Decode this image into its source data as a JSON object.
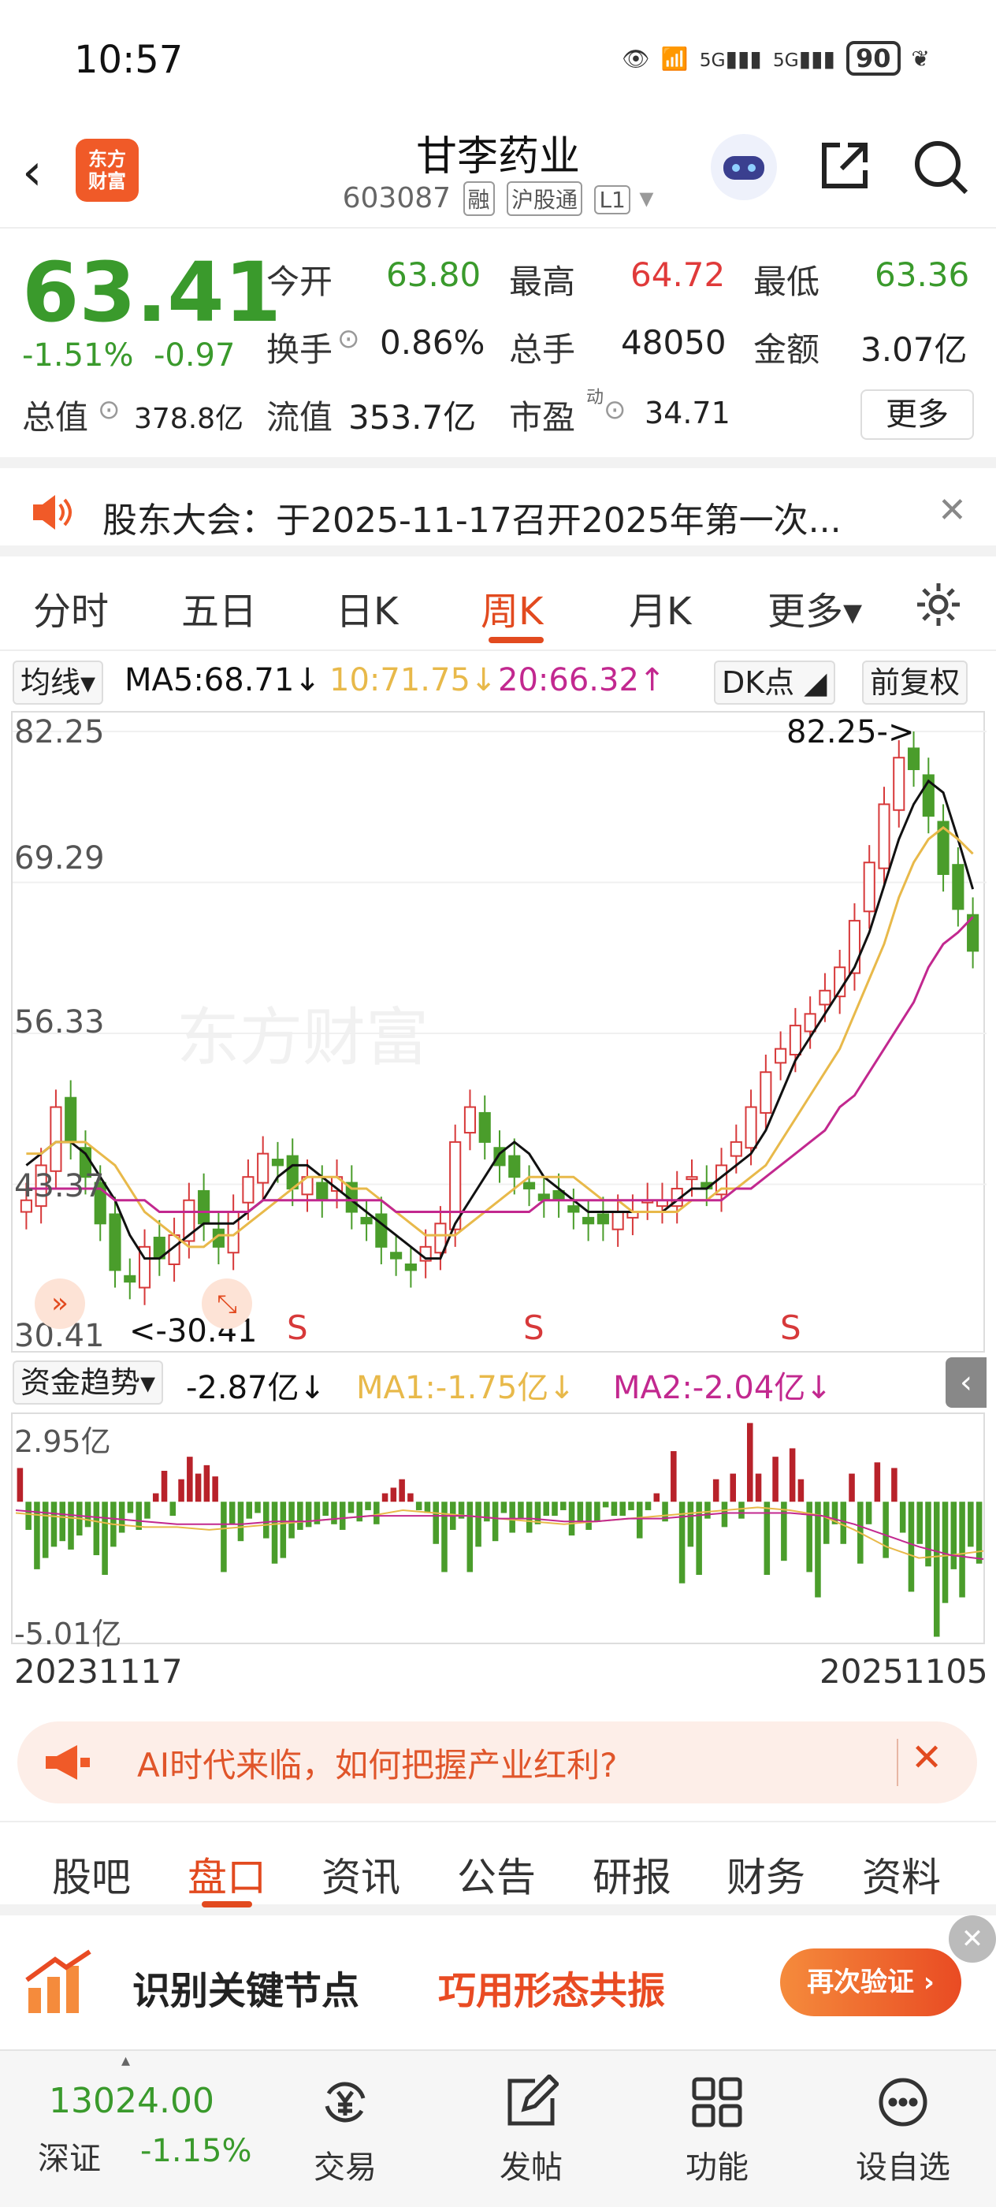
{
  "status_bar": {
    "time": "10:57",
    "signal1": "5G",
    "signal2": "5G",
    "battery": "90"
  },
  "header": {
    "title": "甘李药业",
    "code": "603087",
    "tags": [
      "融",
      "沪股通",
      "L1"
    ],
    "logo_text": "东方\n财富"
  },
  "quote": {
    "price": "63.41",
    "change_pct": "-1.51%",
    "change": "-0.97",
    "open_label": "今开",
    "open": "63.80",
    "high_label": "最高",
    "high": "64.72",
    "low_label": "最低",
    "low": "63.36",
    "turnover_label": "换手",
    "turnover": "0.86%",
    "volume_label": "总手",
    "volume": "48050",
    "amount_label": "金额",
    "amount": "3.07亿",
    "mktcap_label": "总值",
    "mktcap": "378.8亿",
    "float_label": "流值",
    "float_cap": "353.7亿",
    "pe_label": "市盈",
    "pe_sup": "动",
    "pe": "34.71",
    "more_label": "更多"
  },
  "notice": {
    "text": "股东大会：于2025-11-17召开2025年第一次..."
  },
  "tabs": [
    "分时",
    "五日",
    "日K",
    "周K",
    "月K",
    "更多▾"
  ],
  "active_tab": "周K",
  "ma_bar": {
    "selector": "均线▾",
    "ma5": "MA5:68.71↓",
    "ma10": "10:71.75↓",
    "ma20": "20:66.32↑",
    "dk": "DK点",
    "adjust": "前复权"
  },
  "colors": {
    "up": "#d7393a",
    "down": "#4a9d2b",
    "ma5": "#111111",
    "ma10": "#e8b94a",
    "ma20": "#c2288f",
    "accent": "#e24a1f"
  },
  "chart_data": [
    {
      "type": "candlestick",
      "y_labels": [
        "82.25",
        "69.29",
        "56.33",
        "43.37",
        "30.41"
      ],
      "ylim": [
        30.41,
        82.25
      ],
      "max_annotation": "82.25->",
      "min_annotation": "<-30.41",
      "signals": [
        "S",
        "S",
        "S"
      ],
      "watermark": "东方财富",
      "close": [
        42,
        45,
        50,
        47,
        44,
        40,
        36,
        35,
        38,
        37,
        39,
        42,
        40,
        38,
        41,
        44,
        46,
        45,
        43,
        44,
        42,
        44,
        41,
        40,
        38,
        37,
        36,
        38,
        40,
        47,
        50,
        47,
        45,
        44,
        43,
        42,
        42,
        41,
        40,
        40,
        41,
        41,
        42,
        42,
        43,
        44,
        43,
        45,
        47,
        50,
        53,
        55,
        57,
        58,
        60,
        62,
        66,
        71,
        76,
        80,
        79,
        75,
        70,
        67,
        63.41
      ],
      "ma5": [
        45,
        46,
        47,
        47,
        46,
        44,
        42,
        39,
        37,
        37,
        38,
        39,
        40,
        40,
        40,
        41,
        42,
        44,
        45,
        45,
        44,
        43,
        42,
        41,
        40,
        39,
        38,
        37,
        37,
        40,
        42,
        44,
        46,
        47,
        46,
        44,
        43,
        42,
        41,
        41,
        41,
        41,
        41,
        41,
        42,
        43,
        43,
        44,
        45,
        46,
        48,
        51,
        54,
        56,
        58,
        60,
        62,
        65,
        69,
        73,
        76,
        78,
        77,
        73,
        68.71
      ],
      "ma10": [
        46,
        46,
        47,
        47,
        47,
        46,
        45,
        43,
        41,
        40,
        39,
        38,
        38,
        39,
        39,
        40,
        41,
        42,
        43,
        44,
        44,
        44,
        43,
        43,
        42,
        41,
        40,
        39,
        39,
        39,
        40,
        41,
        42,
        43,
        44,
        44,
        44,
        44,
        43,
        42,
        42,
        41,
        41,
        41,
        41,
        42,
        42,
        43,
        43,
        44,
        45,
        47,
        49,
        51,
        53,
        55,
        58,
        61,
        64,
        68,
        71,
        73,
        74,
        73,
        71.75
      ],
      "ma20": [
        43,
        43,
        43,
        43,
        43,
        43,
        42,
        42,
        42,
        41,
        41,
        41,
        41,
        41,
        41,
        41,
        42,
        42,
        42,
        42,
        42,
        42,
        42,
        42,
        42,
        41,
        41,
        41,
        41,
        41,
        41,
        41,
        41,
        41,
        41,
        42,
        42,
        42,
        42,
        42,
        42,
        42,
        42,
        42,
        42,
        42,
        42,
        42,
        43,
        43,
        44,
        45,
        46,
        47,
        48,
        50,
        51,
        53,
        55,
        57,
        59,
        62,
        64,
        65,
        66.32
      ]
    },
    {
      "type": "bar",
      "title": "资金趋势",
      "y_labels": [
        "2.95亿",
        "-5.01亿"
      ],
      "ylim": [
        -5.01,
        2.95
      ],
      "values": [
        1.2,
        -1.0,
        -2.4,
        -2.0,
        -1.6,
        -1.4,
        -1.7,
        -1.2,
        -0.9,
        -1.9,
        -2.6,
        -1.6,
        -1.1,
        -0.4,
        -1.0,
        -0.6,
        0.3,
        1.1,
        -0.5,
        0.8,
        1.6,
        1.0,
        1.3,
        0.9,
        -2.5,
        -0.8,
        -1.4,
        -0.6,
        -0.4,
        -1.3,
        -2.2,
        -2.0,
        -1.3,
        -1.0,
        -0.9,
        -0.8,
        -0.5,
        -0.8,
        -1.0,
        -0.4,
        -0.7,
        -0.3,
        -0.8,
        0.3,
        0.5,
        0.8,
        0.3,
        -0.3,
        -0.4,
        -1.5,
        -2.5,
        -1.0,
        -0.6,
        -2.5,
        -1.6,
        -0.7,
        -1.4,
        -0.4,
        -1.1,
        -0.6,
        -1.1,
        -0.8,
        -0.5,
        -0.5,
        -0.3,
        -1.2,
        -0.7,
        -1.0,
        -0.7,
        -0.2,
        -0.5,
        -0.5,
        -0.3,
        -1.3,
        -0.3,
        0.3,
        -0.7,
        1.8,
        -2.9,
        -1.6,
        -2.6,
        -0.6,
        0.8,
        -0.9,
        1.0,
        -0.6,
        2.8,
        1.0,
        -2.6,
        1.6,
        -2.1,
        1.9,
        0.8,
        -2.5,
        -3.4,
        -1.5,
        -0.8,
        -1.5,
        1.0,
        -2.2,
        -0.8,
        1.4,
        -2.0,
        1.2,
        -1.1,
        -3.2,
        -1.5,
        -2.3,
        -4.8,
        -3.6,
        -2.4,
        -3.4,
        -1.6,
        -2.2
      ],
      "ma1": [
        -0.4,
        -0.5,
        -0.6,
        -0.8,
        -0.9,
        -0.9,
        -1.0,
        -0.9,
        -0.8,
        -0.7,
        -0.6,
        -0.5,
        -0.3,
        -0.4,
        -0.5,
        -0.6,
        -0.7,
        -0.8,
        -0.7,
        -0.6,
        -0.5,
        -0.4,
        -0.3,
        -0.2,
        -0.3,
        -0.5,
        -1.0,
        -1.6,
        -2.0,
        -1.9,
        -1.75
      ],
      "ma2": [
        -0.3,
        -0.4,
        -0.5,
        -0.6,
        -0.7,
        -0.8,
        -0.8,
        -0.8,
        -0.7,
        -0.7,
        -0.6,
        -0.5,
        -0.5,
        -0.5,
        -0.5,
        -0.6,
        -0.6,
        -0.7,
        -0.7,
        -0.6,
        -0.6,
        -0.5,
        -0.4,
        -0.4,
        -0.4,
        -0.5,
        -0.8,
        -1.2,
        -1.6,
        -1.9,
        -2.04
      ]
    }
  ],
  "fund_bar": {
    "selector": "资金趋势▾",
    "value": "-2.87亿↓",
    "ma1": "MA1:-1.75亿↓",
    "ma2": "MA2:-2.04亿↓"
  },
  "dates": {
    "start": "20231117",
    "end": "20251105"
  },
  "promo": {
    "text": "AI时代来临，如何把握产业红利?"
  },
  "bottom_tabs": [
    "股吧",
    "盘口",
    "资讯",
    "公告",
    "研报",
    "财务",
    "资料"
  ],
  "active_bottom_tab": "盘口",
  "ad": {
    "title": "识别关键节点",
    "subtitle": "巧用形态共振",
    "button": "再次验证"
  },
  "bottom_nav": {
    "index_value": "13024.00",
    "index_name": "深证",
    "index_change": "-1.15%",
    "items": [
      {
        "label": "交易",
        "icon": "yen-refresh-icon"
      },
      {
        "label": "发帖",
        "icon": "edit-icon"
      },
      {
        "label": "功能",
        "icon": "grid-icon"
      },
      {
        "label": "设自选",
        "icon": "more-dots-icon"
      }
    ]
  }
}
